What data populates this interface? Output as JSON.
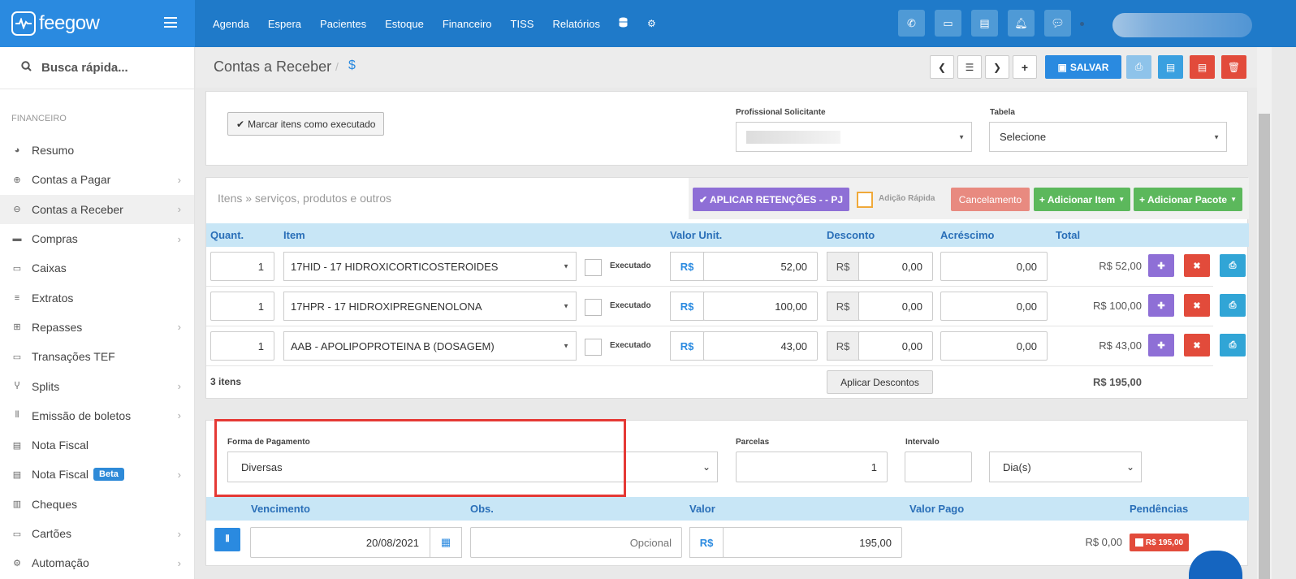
{
  "brand": {
    "name": "feegow"
  },
  "topnav": [
    "Agenda",
    "Espera",
    "Pacientes",
    "Estoque",
    "Financeiro",
    "TISS",
    "Relatórios"
  ],
  "sidebar": {
    "search_label": "Busca rápida...",
    "section": "FINANCEIRO",
    "items": [
      {
        "label": "Resumo",
        "icon": "pie-chart-icon",
        "glyph": "◕",
        "chev": false
      },
      {
        "label": "Contas a Pagar",
        "icon": "arrow-up-circle-icon",
        "glyph": "⊕",
        "chev": true
      },
      {
        "label": "Contas a Receber",
        "icon": "arrow-down-circle-icon",
        "glyph": "⊖",
        "chev": true,
        "active": true
      },
      {
        "label": "Compras",
        "icon": "cart-icon",
        "glyph": "▬",
        "chev": true
      },
      {
        "label": "Caixas",
        "icon": "inbox-icon",
        "glyph": "▭",
        "chev": false
      },
      {
        "label": "Extratos",
        "icon": "list-icon",
        "glyph": "≡",
        "chev": false
      },
      {
        "label": "Repasses",
        "icon": "sitemap-icon",
        "glyph": "⊞",
        "chev": true
      },
      {
        "label": "Transações TEF",
        "icon": "credit-card-icon",
        "glyph": "▭",
        "chev": false
      },
      {
        "label": "Splits",
        "icon": "split-icon",
        "glyph": "Ⴤ",
        "chev": true
      },
      {
        "label": "Emissão de boletos",
        "icon": "barcode-icon",
        "glyph": "⦀",
        "chev": true
      },
      {
        "label": "Nota Fiscal",
        "icon": "file-icon",
        "glyph": "▤",
        "chev": false
      },
      {
        "label": "Nota Fiscal",
        "icon": "file-icon",
        "glyph": "▤",
        "chev": true,
        "badge": "Beta"
      },
      {
        "label": "Cheques",
        "icon": "money-icon",
        "glyph": "▥",
        "chev": false
      },
      {
        "label": "Cartões",
        "icon": "card-icon",
        "glyph": "▭",
        "chev": true
      },
      {
        "label": "Automação",
        "icon": "cogs-icon",
        "glyph": "⚙",
        "chev": true
      }
    ]
  },
  "header": {
    "title": "Contas a Receber",
    "separator": "/",
    "current": "$",
    "save_label": "SALVAR"
  },
  "top_panel": {
    "mark_executed": "Marcar itens como executado",
    "profissional_label": "Profissional Solicitante",
    "tabela_label": "Tabela",
    "tabela_value": "Selecione"
  },
  "items_panel": {
    "title": "Itens » serviços, produtos e outros",
    "apply_retentions": "APLICAR RETENÇÕES - - PJ",
    "quick_add": "Adição Rápida",
    "cancel": "Cancelamento",
    "add_item": "Adicionar Item",
    "add_package": "Adicionar Pacote",
    "columns": {
      "qty": "Quant.",
      "item": "Item",
      "unit": "Valor Unit.",
      "discount": "Desconto",
      "addition": "Acréscimo",
      "total": "Total"
    },
    "currency": "R$",
    "executed_label": "Executado",
    "rows": [
      {
        "qty": "1",
        "item": "17HID - 17 HIDROXICORTICOSTEROIDES",
        "unit": "52,00",
        "discount": "0,00",
        "addition": "0,00",
        "total": "R$ 52,00"
      },
      {
        "qty": "1",
        "item": "17HPR - 17 HIDROXIPREGNENOLONA",
        "unit": "100,00",
        "discount": "0,00",
        "addition": "0,00",
        "total": "R$ 100,00"
      },
      {
        "qty": "1",
        "item": "AAB - APOLIPOPROTEINA B (DOSAGEM)",
        "unit": "43,00",
        "discount": "0,00",
        "addition": "0,00",
        "total": "R$ 43,00"
      }
    ],
    "count": "3 itens",
    "apply_discounts": "Aplicar Descontos",
    "grand_total": "R$ 195,00"
  },
  "payment": {
    "forma_label": "Forma de Pagamento",
    "forma_value": "Diversas",
    "parcelas_label": "Parcelas",
    "parcelas_value": "1",
    "intervalo_label": "Intervalo",
    "intervalo_value": "",
    "unit_value": "Dia(s)",
    "columns": {
      "due": "Vencimento",
      "obs": "Obs.",
      "value": "Valor",
      "paid": "Valor Pago",
      "pending": "Pendências"
    },
    "row": {
      "due": "20/08/2021",
      "obs_placeholder": "Opcional",
      "value": "195,00",
      "paid": "R$ 0,00",
      "pending": "R$ 195,00"
    }
  },
  "colors": {
    "primary": "#2a8ae0",
    "topbar": "#1f7ac9",
    "purple": "#8e6fd6",
    "green": "#5cb85c",
    "red": "#d9534f",
    "cyan": "#31a5d6",
    "highlight": "#e53935"
  }
}
